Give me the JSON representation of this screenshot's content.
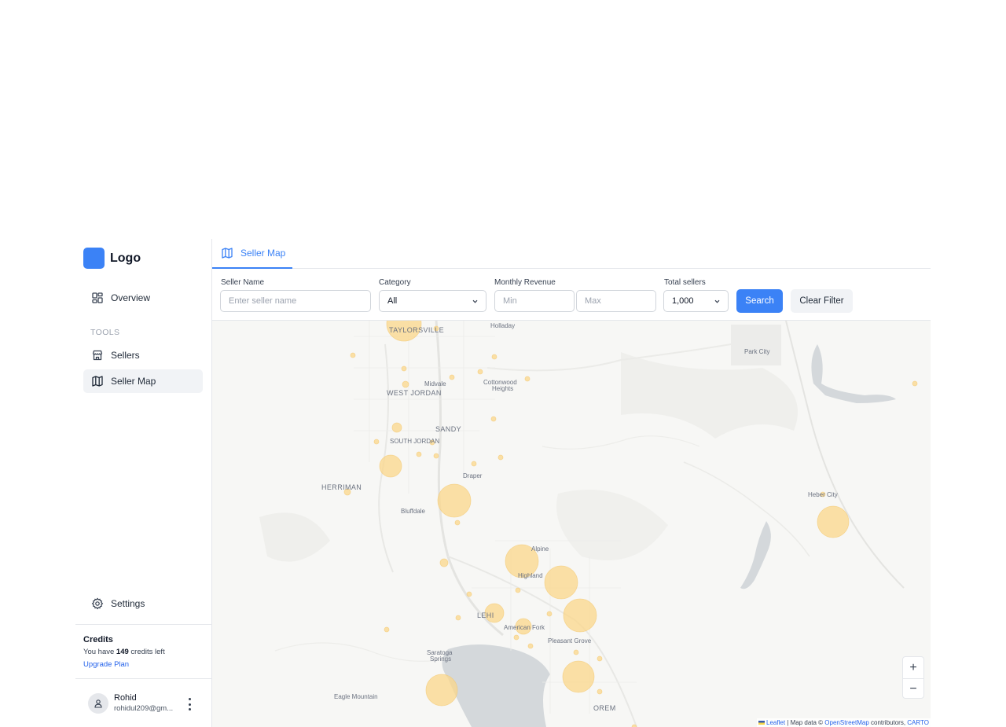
{
  "app": {
    "logo_text": "Logo",
    "brand_color": "#3b82f6"
  },
  "sidebar": {
    "overview_label": "Overview",
    "section_label": "TOOLS",
    "items": [
      {
        "label": "Sellers",
        "icon": "store-icon"
      },
      {
        "label": "Seller Map",
        "icon": "map-icon",
        "active": true
      }
    ],
    "settings_label": "Settings"
  },
  "credits": {
    "title": "Credits",
    "prefix": "You have",
    "count": "149",
    "suffix": "credits left",
    "upgrade_label": "Upgrade Plan"
  },
  "user": {
    "name": "Rohid",
    "email": "rohidul209@gm..."
  },
  "tabs": [
    {
      "label": "Seller Map",
      "icon": "map-icon",
      "active": true
    }
  ],
  "filters": {
    "seller_name": {
      "label": "Seller Name",
      "placeholder": "Enter seller name",
      "value": ""
    },
    "category": {
      "label": "Category",
      "value": "All"
    },
    "monthly_revenue": {
      "label": "Monthly Revenue",
      "min_placeholder": "Min",
      "max_placeholder": "Max"
    },
    "total_sellers": {
      "label": "Total sellers",
      "value": "1,000"
    },
    "search_label": "Search",
    "clear_label": "Clear Filter"
  },
  "map": {
    "places": {
      "taylorsville": "TAYLORSVILLE",
      "holladay": "Holladay",
      "park_city": "Park City",
      "midvale": "Midvale",
      "cottonwood": "Cottonwood",
      "heights": "Heights",
      "west_jordan": "WEST JORDAN",
      "sandy": "SANDY",
      "south_jordan": "SOUTH JORDAN",
      "draper": "Draper",
      "herriman": "HERRIMAN",
      "bluffdale": "Bluffdale",
      "heber_city": "Heber City",
      "alpine": "Alpine",
      "highland": "Highland",
      "lehi": "LEHI",
      "american_fork": "American Fork",
      "pleasant_grove": "Pleasant Grove",
      "saratoga": "Saratoga",
      "springs": "Springs",
      "eagle_mountain": "Eagle Mountain",
      "orem": "OREM"
    },
    "zoom_in": "+",
    "zoom_out": "−",
    "attribution": {
      "leaflet": "Leaflet",
      "map_data": "| Map data ©",
      "osm": "OpenStreetMap",
      "contributors": "contributors,",
      "carto": "CARTO"
    },
    "marker_color": "#fbd78a"
  }
}
